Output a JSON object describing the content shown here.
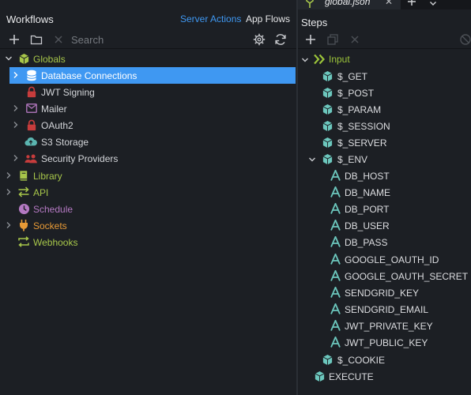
{
  "left_panel": {
    "title": "Workflows",
    "tabs": {
      "server_actions": "Server Actions",
      "app_flows": "App Flows"
    },
    "search": {
      "placeholder": "Search",
      "value": ""
    },
    "tree": {
      "globals": "Globals",
      "database_connections": "Database Connections",
      "jwt_signing": "JWT Signing",
      "mailer": "Mailer",
      "oauth2": "OAuth2",
      "s3_storage": "S3 Storage",
      "security_providers": "Security Providers",
      "library": "Library",
      "api": "API",
      "schedule": "Schedule",
      "sockets": "Sockets",
      "webhooks": "Webhooks"
    }
  },
  "right_panel": {
    "tab_label": "global.json",
    "title": "Steps",
    "input": "Input",
    "items": {
      "get": "$_GET",
      "post": "$_POST",
      "param": "$_PARAM",
      "session": "$_SESSION",
      "server": "$_SERVER",
      "env": "$_ENV",
      "cookie": "$_COOKIE",
      "execute": "EXECUTE"
    },
    "env_vars": [
      "DB_HOST",
      "DB_NAME",
      "DB_PORT",
      "DB_USER",
      "DB_PASS",
      "GOOGLE_OAUTH_ID",
      "GOOGLE_OAUTH_SECRET",
      "SENDGRID_KEY",
      "SENDGRID_EMAIL",
      "JWT_PRIVATE_KEY",
      "JWT_PUBLIC_KEY"
    ]
  },
  "colors": {
    "accent": "#3f98f2",
    "globals": "#a7c64a",
    "security_red": "#c73c3c",
    "mailer_purple": "#a46fb0",
    "s3_teal": "#5bb5b0",
    "schedule_purple": "#b479c2",
    "sockets_orange": "#e79a36",
    "env_var_teal": "#6cc7bd",
    "input_green": "#9bc33a"
  }
}
